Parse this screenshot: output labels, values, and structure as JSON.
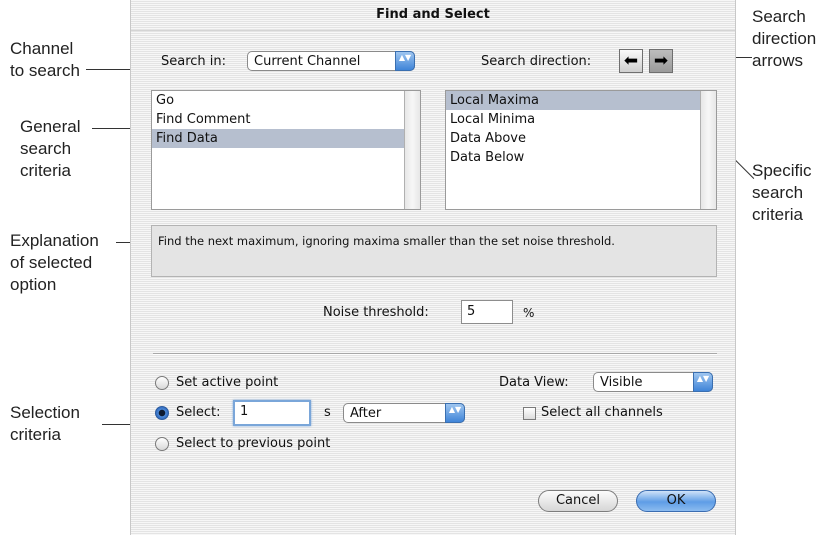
{
  "dialog": {
    "title": "Find and Select",
    "search_in_label": "Search in:",
    "search_in_value": "Current Channel",
    "search_direction_label": "Search direction:",
    "direction_left_icon": "⬅",
    "direction_right_icon": "➡",
    "general_criteria": [
      "Go",
      "Find Comment",
      "Find Data"
    ],
    "general_selected_index": 2,
    "specific_criteria": [
      "Local Maxima",
      "Local Minima",
      "Data Above",
      "Data Below"
    ],
    "specific_selected_index": 0,
    "explanation": "Find the next maximum, ignoring maxima smaller than the set noise threshold.",
    "noise_threshold_label": "Noise threshold:",
    "noise_threshold_value": "5",
    "noise_threshold_unit": "%",
    "set_active_point_label": "Set active point",
    "select_label": "Select:",
    "select_value": "1",
    "select_unit": "s",
    "select_relation": "After",
    "select_previous_label": "Select to previous point",
    "data_view_label": "Data View:",
    "data_view_value": "Visible",
    "select_all_channels_label": "Select all channels",
    "selected_radio": "select",
    "cancel_label": "Cancel",
    "ok_label": "OK",
    "popup_arrow_icon": "▲▼"
  },
  "callouts": {
    "channel": [
      "Channel",
      "to search"
    ],
    "general": [
      "General",
      "search",
      "criteria"
    ],
    "explanation": [
      "Explanation",
      "of selected",
      "option"
    ],
    "selection": [
      "Selection",
      "criteria"
    ],
    "direction": [
      "Search",
      "direction",
      "arrows"
    ],
    "specific": [
      "Specific",
      "search",
      "criteria"
    ]
  },
  "colors": {
    "selection_highlight": "#b6bfcf",
    "aqua_blue": "#5e9de6"
  }
}
